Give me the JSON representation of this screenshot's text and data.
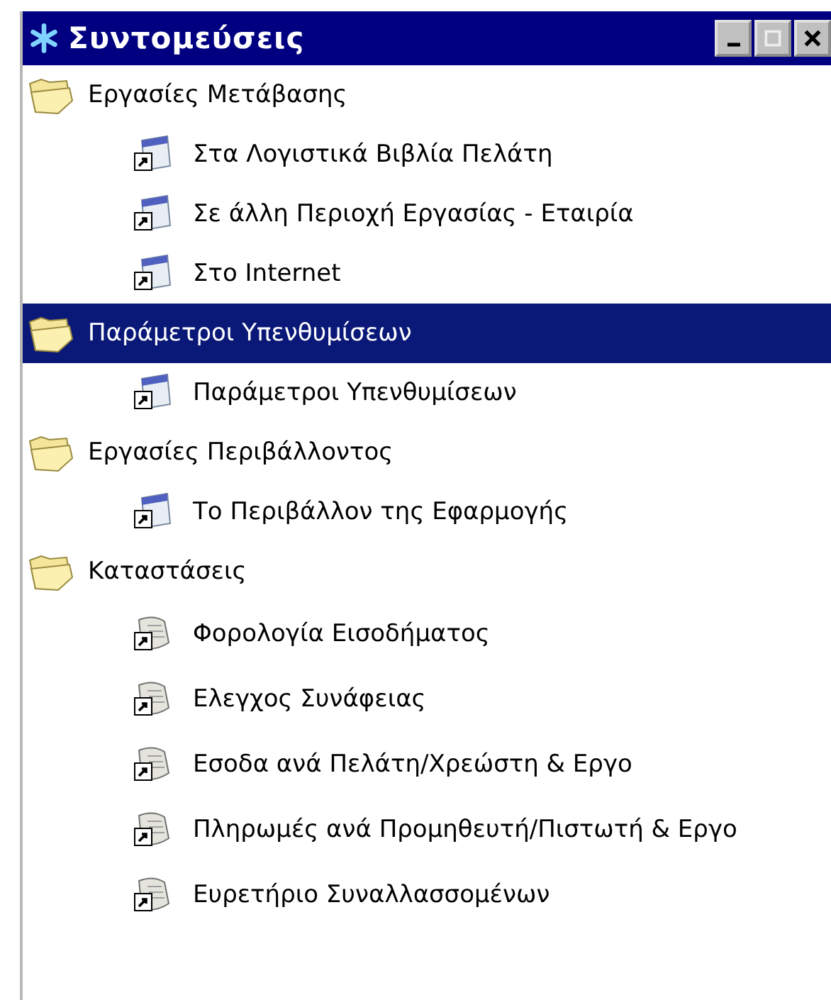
{
  "window": {
    "title": "Συντομεύσεις"
  },
  "folders": [
    {
      "label": "Εργασίες Μετάβασης",
      "selected": false,
      "children": [
        {
          "label": "Στα Λογιστικά Βιβλία Πελάτη",
          "kind": "window"
        },
        {
          "label": "Σε άλλη Περιοχή Εργασίας - Εταιρία",
          "kind": "window"
        },
        {
          "label": "Στο Internet",
          "kind": "window"
        }
      ]
    },
    {
      "label": "Παράμετροι Υπενθυμίσεων",
      "selected": true,
      "children": [
        {
          "label": "Παράμετροι Υπενθυμίσεων",
          "kind": "window"
        }
      ]
    },
    {
      "label": "Εργασίες Περιβάλλοντος",
      "selected": false,
      "children": [
        {
          "label": "Το Περιβάλλον της Εφαρμογής",
          "kind": "window"
        }
      ]
    },
    {
      "label": "Καταστάσεις",
      "selected": false,
      "children": [
        {
          "label": "Φορολογία Εισοδήματος",
          "kind": "report"
        },
        {
          "label": "Ελεγχος Συνάφειας",
          "kind": "report"
        },
        {
          "label": "Εσοδα ανά Πελάτη/Χρεώστη & Εργο",
          "kind": "report"
        },
        {
          "label": "Πληρωμές ανά Προμηθευτή/Πιστωτή & Εργο",
          "kind": "report"
        },
        {
          "label": "Ευρετήριο Συναλλασσομένων",
          "kind": "report"
        }
      ]
    }
  ]
}
